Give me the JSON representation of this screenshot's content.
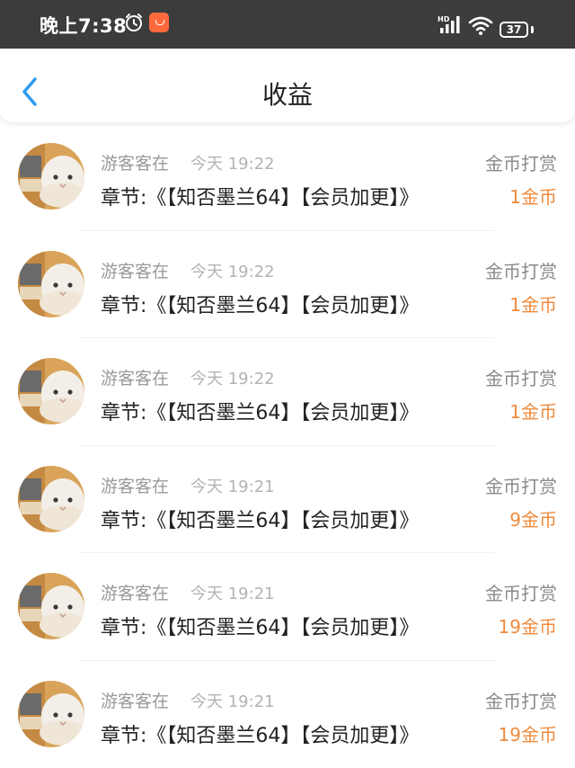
{
  "status_bar": {
    "time": "晚上7:38",
    "network": "HD",
    "battery": "37"
  },
  "nav": {
    "title": "收益"
  },
  "colors": {
    "accent_blue": "#2e9bf0",
    "amount_orange": "#ef8a3c"
  },
  "records": [
    {
      "user": "游客客在",
      "time": "今天 19:22",
      "chapter": "章节:《【知否墨兰64】【会员加更】》",
      "type": "金币打赏",
      "amount": "1金币"
    },
    {
      "user": "游客客在",
      "time": "今天 19:22",
      "chapter": "章节:《【知否墨兰64】【会员加更】》",
      "type": "金币打赏",
      "amount": "1金币"
    },
    {
      "user": "游客客在",
      "time": "今天 19:22",
      "chapter": "章节:《【知否墨兰64】【会员加更】》",
      "type": "金币打赏",
      "amount": "1金币"
    },
    {
      "user": "游客客在",
      "time": "今天 19:21",
      "chapter": "章节:《【知否墨兰64】【会员加更】》",
      "type": "金币打赏",
      "amount": "9金币"
    },
    {
      "user": "游客客在",
      "time": "今天 19:21",
      "chapter": "章节:《【知否墨兰64】【会员加更】》",
      "type": "金币打赏",
      "amount": "19金币"
    },
    {
      "user": "游客客在",
      "time": "今天 19:21",
      "chapter": "章节:《【知否墨兰64】【会员加更】》",
      "type": "金币打赏",
      "amount": "19金币"
    }
  ]
}
